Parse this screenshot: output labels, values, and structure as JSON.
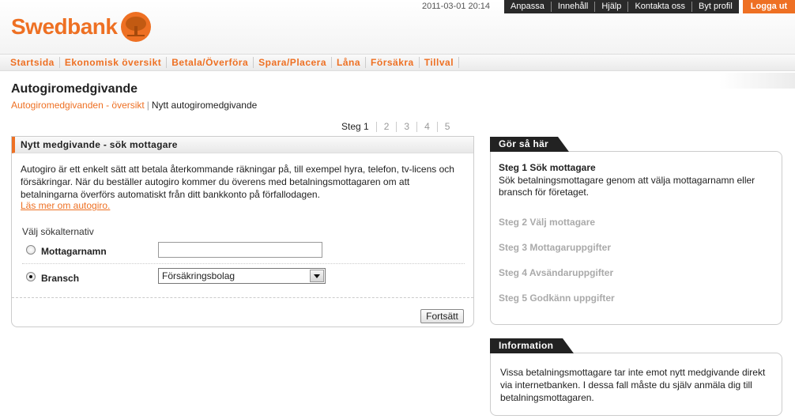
{
  "header": {
    "brand": "Swedbank",
    "datetime": "2011-03-01 20:14",
    "links": [
      "Anpassa",
      "Innehåll",
      "Hjälp",
      "Kontakta oss",
      "Byt profil"
    ],
    "logout": "Logga ut"
  },
  "nav": [
    "Startsida",
    "Ekonomisk översikt",
    "Betala/Överföra",
    "Spara/Placera",
    "Låna",
    "Försäkra",
    "Tillval"
  ],
  "page": {
    "title": "Autogiromedgivande",
    "breadcrumb_link": "Autogiromedgivanden - översikt",
    "breadcrumb_separator": "|",
    "breadcrumb_current": "Nytt autogiromedgivande"
  },
  "steps": [
    "Steg 1",
    "2",
    "3",
    "4",
    "5"
  ],
  "form": {
    "heading": "Nytt medgivande - sök mottagare",
    "intro": "Autogiro är ett enkelt sätt att betala återkommande räkningar på, till exempel hyra, telefon, tv-licens och försäkringar. När du beställer autogiro kommer du överens med betalningsmottagaren om att betalningarna överförs automatiskt från ditt bankkonto på förfallodagen.",
    "read_more": "Läs mer om autogiro.",
    "search_label": "Välj sökalternativ",
    "option_name": "Mottagarnamn",
    "name_value": "",
    "option_branch": "Bransch",
    "branch_selected": "Försäkringsbolag",
    "continue": "Fortsätt"
  },
  "howto": {
    "heading": "Gör så här",
    "step1_title": "Steg 1 Sök mottagare",
    "step1_desc": "Sök betalningsmottagare genom att välja mottagarnamn eller bransch för företaget.",
    "step2": "Steg 2 Välj mottagare",
    "step3": "Steg 3 Mottagaruppgifter",
    "step4": "Steg 4 Avsändaruppgifter",
    "step5": "Steg 5 Godkänn uppgifter"
  },
  "info": {
    "heading": "Information",
    "text": "Vissa betalningsmottagare tar inte emot nytt medgivande direkt via internetbanken. I dessa fall måste du själv anmäla dig till betalningsmottagaren."
  },
  "colors": {
    "accent": "#ee7023",
    "dark": "#222222"
  }
}
